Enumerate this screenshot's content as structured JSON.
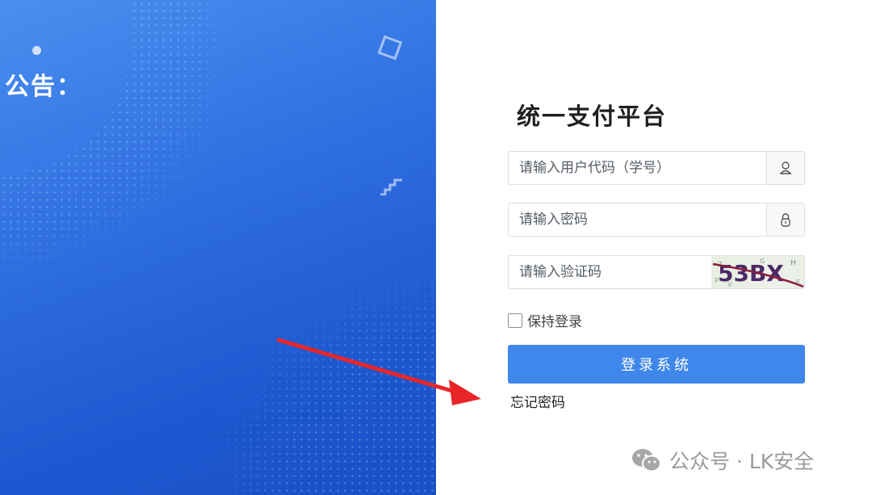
{
  "announcement": {
    "title": "公告："
  },
  "login": {
    "title": "统一支付平台",
    "username_placeholder": "请输入用户代码（学号）",
    "password_placeholder": "请输入密码",
    "captcha_placeholder": "请输入验证码",
    "captcha_text": "53BX",
    "remember_label": "保持登录",
    "remember_checked": false,
    "submit_label": "登录系统",
    "forgot_label": "忘记密码"
  },
  "icons": {
    "username": "user-icon",
    "password": "lock-icon",
    "arrow": "red-arrow-annotation",
    "wechat": "wechat-icon"
  },
  "watermark": {
    "text": "公众号 · LK安全"
  },
  "colors": {
    "panel_blue": "#2f6fe0",
    "button_blue": "#3f87ea",
    "arrow_red": "#e8262a"
  }
}
